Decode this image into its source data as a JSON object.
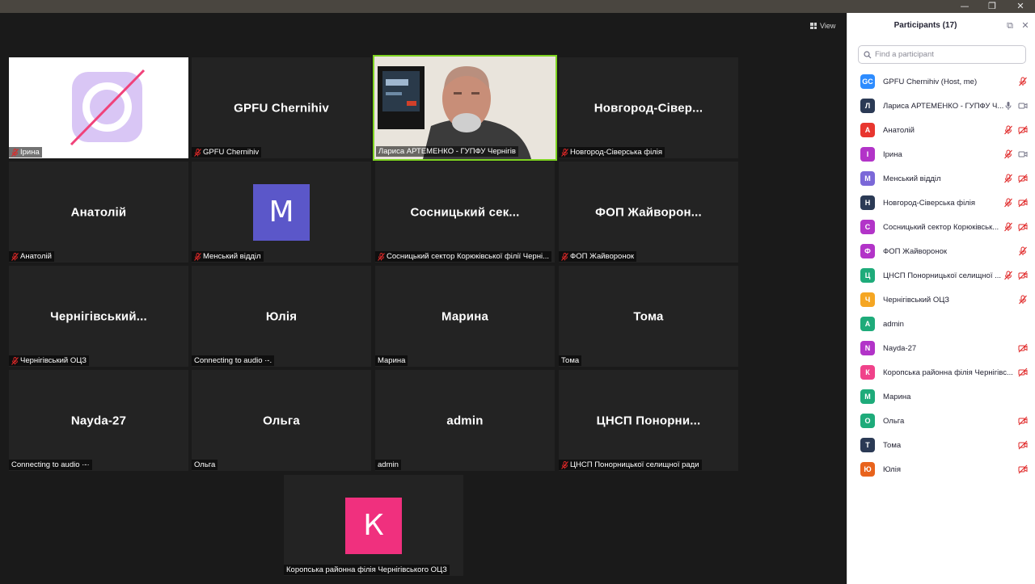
{
  "window": {
    "minimize": "—",
    "restore": "❐",
    "close": "✕"
  },
  "toolbar": {
    "view_label": "View"
  },
  "tiles": [
    {
      "id": "iryna",
      "caption": "Ірина",
      "big": "",
      "muted": true
    },
    {
      "id": "gpfu",
      "caption": "GPFU Chernihiv",
      "big": "GPFU Chernihiv",
      "muted": true
    },
    {
      "id": "larysa",
      "caption": "Лариса АРТЕМЕНКО - ГУПФУ Чернігів",
      "big": "",
      "muted": false
    },
    {
      "id": "novgorod",
      "caption": "Новгород-Сіверська філія",
      "big": "Новгород-Сівер...",
      "muted": true
    },
    {
      "id": "anatoliy",
      "caption": "Анатолій",
      "big": "Анатолій",
      "muted": true
    },
    {
      "id": "menskyi",
      "caption": "Менський відділ",
      "big": "",
      "avatar": "М",
      "muted": true
    },
    {
      "id": "sosnytskyi",
      "caption": "Сосницький сектор Корюківської філії Черні...",
      "big": "Сосницький сек...",
      "muted": true
    },
    {
      "id": "fop",
      "caption": "ФОП Жайворонок",
      "big": "ФОП Жайворон...",
      "muted": true
    },
    {
      "id": "chernihivskyi",
      "caption": "Чернігівський ОЦЗ",
      "big": "Чернігівський...",
      "muted": true
    },
    {
      "id": "yulia",
      "caption": "Connecting to audio ·-.",
      "big": "Юлія",
      "muted": false
    },
    {
      "id": "maryna",
      "caption": "Марина",
      "big": "Марина",
      "muted": false
    },
    {
      "id": "toma",
      "caption": "Тома",
      "big": "Тома",
      "muted": false
    },
    {
      "id": "nayda",
      "caption": "Connecting to audio ·-·",
      "big": "Nayda-27",
      "muted": false
    },
    {
      "id": "olga",
      "caption": "Ольга",
      "big": "Ольга",
      "muted": false
    },
    {
      "id": "admin",
      "caption": "admin",
      "big": "admin",
      "muted": false
    },
    {
      "id": "tsnsp",
      "caption": "ЦНСП Понорницької селищної ради",
      "big": "ЦНСП Понорни...",
      "muted": true
    },
    {
      "id": "koropska",
      "caption": "Коропська районна філія Чернігівського ОЦЗ",
      "big": "",
      "avatar": "К",
      "muted": false
    }
  ],
  "panel": {
    "title": "Participants (17)",
    "search_placeholder": "Find a participant",
    "participants": [
      {
        "initials": "GC",
        "name": "GPFU Chernihiv (Host, me)",
        "color": "#2d8cff",
        "mic": "muted",
        "video": ""
      },
      {
        "initials": "Л",
        "name": "Лариса АРТЕМЕНКО - ГУПФУ Ч...",
        "color": "#2b3a55",
        "mic": "on",
        "video": "on"
      },
      {
        "initials": "А",
        "name": "Анатолій",
        "color": "#e8362f",
        "mic": "muted",
        "video": "off"
      },
      {
        "initials": "І",
        "name": "Ірина",
        "color": "#b234c8",
        "mic": "muted",
        "video": "on"
      },
      {
        "initials": "М",
        "name": "Менський відділ",
        "color": "#7b68d8",
        "mic": "muted",
        "video": "off"
      },
      {
        "initials": "Н",
        "name": "Новгород-Сіверська філія",
        "color": "#2b3a55",
        "mic": "muted",
        "video": "off"
      },
      {
        "initials": "С",
        "name": "Сосницький сектор Корюківськ...",
        "color": "#b234c8",
        "mic": "muted",
        "video": "off"
      },
      {
        "initials": "Ф",
        "name": "ФОП Жайворонок",
        "color": "#b234c8",
        "mic": "muted",
        "video": ""
      },
      {
        "initials": "Ц",
        "name": "ЦНСП Понорницької селищної ...",
        "color": "#1eab7a",
        "mic": "muted",
        "video": "off"
      },
      {
        "initials": "Ч",
        "name": "Чернігівський ОЦЗ",
        "color": "#f5a623",
        "mic": "muted",
        "video": ""
      },
      {
        "initials": "A",
        "name": "admin",
        "color": "#1eab7a",
        "mic": "",
        "video": ""
      },
      {
        "initials": "N",
        "name": "Nayda-27",
        "color": "#b234c8",
        "mic": "",
        "video": "off"
      },
      {
        "initials": "К",
        "name": "Коропська районна філія Чернігівс...",
        "color": "#f0428a",
        "mic": "",
        "video": "off"
      },
      {
        "initials": "М",
        "name": "Марина",
        "color": "#1eab7a",
        "mic": "",
        "video": ""
      },
      {
        "initials": "О",
        "name": "Ольга",
        "color": "#1eab7a",
        "mic": "",
        "video": "off"
      },
      {
        "initials": "Т",
        "name": "Тома",
        "color": "#2b3a55",
        "mic": "",
        "video": "off"
      },
      {
        "initials": "Ю",
        "name": "Юлія",
        "color": "#e8631c",
        "mic": "",
        "video": "off"
      }
    ]
  }
}
